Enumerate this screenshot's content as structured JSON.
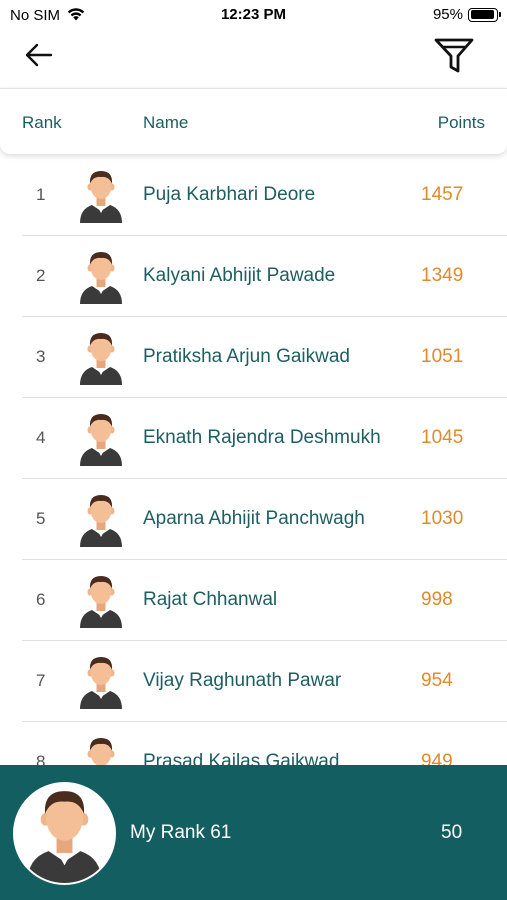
{
  "status_bar": {
    "carrier": "No SIM",
    "time": "12:23 PM",
    "battery": "95%",
    "battery_level": 0.95
  },
  "nav": {
    "back_icon": "arrow-left-icon",
    "filter_icon": "filter-icon"
  },
  "table_header": {
    "rank": "Rank",
    "name": "Name",
    "points": "Points"
  },
  "leaderboard": [
    {
      "rank": "1",
      "name": "Puja Karbhari Deore",
      "points": "1457"
    },
    {
      "rank": "2",
      "name": "Kalyani Abhijit Pawade",
      "points": "1349"
    },
    {
      "rank": "3",
      "name": "Pratiksha Arjun Gaikwad",
      "points": "1051"
    },
    {
      "rank": "4",
      "name": "Eknath Rajendra Deshmukh",
      "points": "1045"
    },
    {
      "rank": "5",
      "name": "Aparna Abhijit Panchwagh",
      "points": "1030"
    },
    {
      "rank": "6",
      "name": "Rajat Chhanwal",
      "points": "998"
    },
    {
      "rank": "7",
      "name": "Vijay Raghunath Pawar",
      "points": "954"
    },
    {
      "rank": "8",
      "name": "Prasad Kailas Gaikwad",
      "points": "949"
    }
  ],
  "footer": {
    "my_rank": "My Rank 61",
    "my_points": "50"
  },
  "colors": {
    "accent": "#135e61",
    "points": "#e08a2a",
    "text": "#1d5e61"
  }
}
